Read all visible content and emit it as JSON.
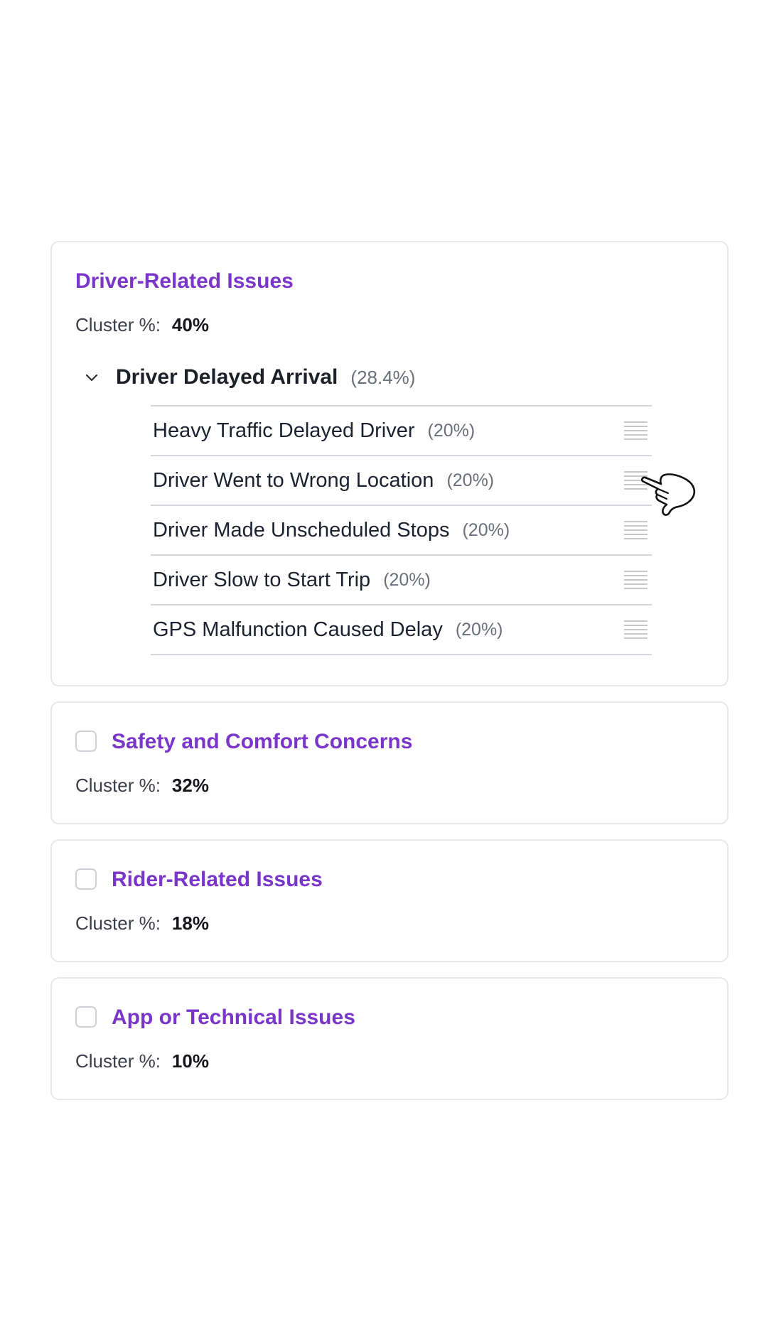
{
  "clusters": [
    {
      "title": "Driver-Related Issues",
      "meta_label": "Cluster %:",
      "meta_value": "40%",
      "expanded_group": {
        "title": "Driver Delayed Arrival",
        "pct": "(28.4%)",
        "items": [
          {
            "label": "Heavy Traffic Delayed Driver",
            "pct": "(20%)"
          },
          {
            "label": "Driver Went to Wrong Location",
            "pct": "(20%)"
          },
          {
            "label": "Driver Made Unscheduled Stops",
            "pct": "(20%)"
          },
          {
            "label": "Driver Slow to Start Trip",
            "pct": "(20%)"
          },
          {
            "label": "GPS Malfunction Caused Delay",
            "pct": "(20%)"
          }
        ]
      }
    },
    {
      "title": "Safety and Comfort Concerns",
      "meta_label": "Cluster %:",
      "meta_value": "32%",
      "checked": false
    },
    {
      "title": "Rider-Related Issues",
      "meta_label": "Cluster %:",
      "meta_value": "18%",
      "checked": false
    },
    {
      "title": "App or Technical Issues",
      "meta_label": "Cluster %:",
      "meta_value": "10%",
      "checked": false
    }
  ],
  "icons": {
    "chevron": "chevron-down-icon",
    "drag": "drag-handle-icon",
    "cursor": "hand-pointer-icon"
  },
  "colors": {
    "accent": "#7a35c9",
    "border": "#e7e7ec",
    "divider": "#d6d8e0"
  }
}
